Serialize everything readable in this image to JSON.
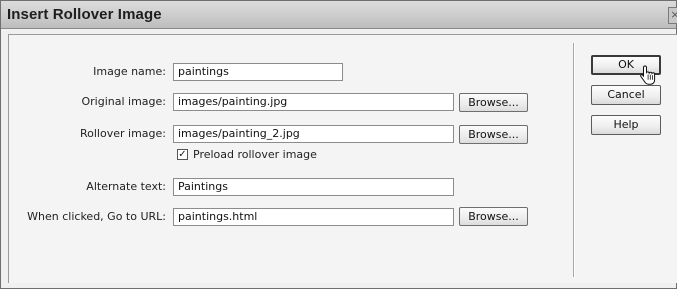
{
  "dialog": {
    "title": "Insert Rollover Image",
    "close_glyph": "×"
  },
  "form": {
    "image_name_label": "Image name:",
    "image_name_value": "paintings",
    "original_image_label": "Original image:",
    "original_image_value": "images/painting.jpg",
    "rollover_image_label": "Rollover image:",
    "rollover_image_value": "images/painting_2.jpg",
    "preload_label": "Preload rollover image",
    "preload_checked": true,
    "preload_check_glyph": "✓",
    "alternate_text_label": "Alternate text:",
    "alternate_text_value": "Paintings",
    "goto_url_label": "When clicked, Go to URL:",
    "goto_url_value": "paintings.html",
    "browse_label": "Browse..."
  },
  "buttons": {
    "ok": "OK",
    "cancel": "Cancel",
    "help": "Help"
  },
  "icons": {
    "cursor": "hand-pointer-icon"
  }
}
